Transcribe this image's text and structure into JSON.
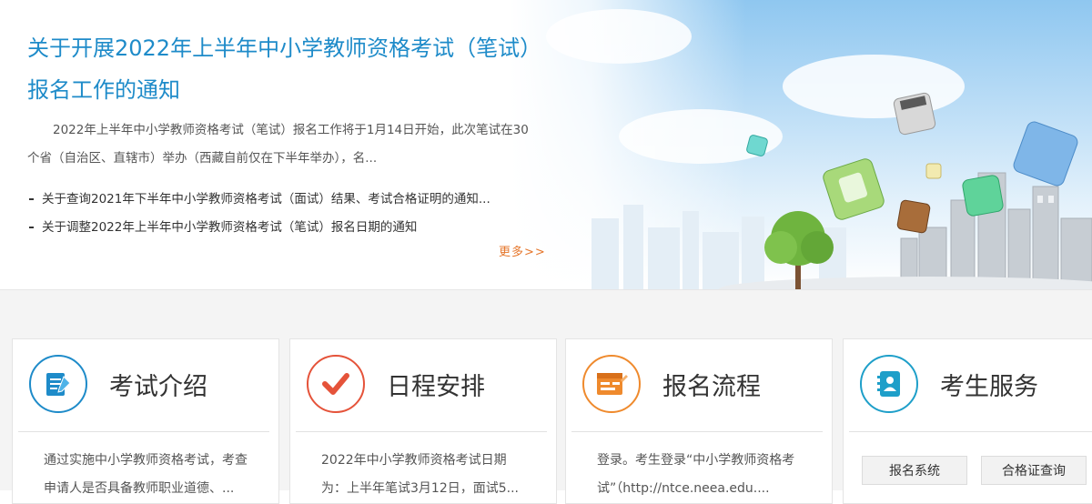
{
  "hero": {
    "title": "关于开展2022年上半年中小学教师资格考试（笔试）报名工作的通知",
    "summary": "2022年上半年中小学教师资格考试（笔试）报名工作将于1月14日开始，此次笔试在30个省（自治区、直辖市）举办（西藏自前仅在下半年举办），名...",
    "links": [
      "关于查询2021年下半年中小学教师资格考试（面试）结果、考试合格证明的通知...",
      "关于调整2022年上半年中小学教师资格考试（笔试）报名日期的通知"
    ],
    "more": "更多>>"
  },
  "cards": [
    {
      "title": "考试介绍",
      "icon": "document-pen-icon",
      "color": "#1e8bc9",
      "body": "通过实施中小学教师资格考试，考查申请人是否具备教师职业道德、..."
    },
    {
      "title": "日程安排",
      "icon": "checkmark-icon",
      "color": "#e5533a",
      "body": "2022年中小学教师资格考试日期为：上半年笔试3月12日，面试5..."
    },
    {
      "title": "报名流程",
      "icon": "registration-form-icon",
      "color": "#ef8a2d",
      "body": "登录。考生登录“中小学教师资格考试”（http://ntce.neea.edu...."
    },
    {
      "title": "考生服务",
      "icon": "address-book-icon",
      "color": "#1e9fc9",
      "buttons": [
        "报名系统",
        "合格证查询"
      ]
    }
  ]
}
